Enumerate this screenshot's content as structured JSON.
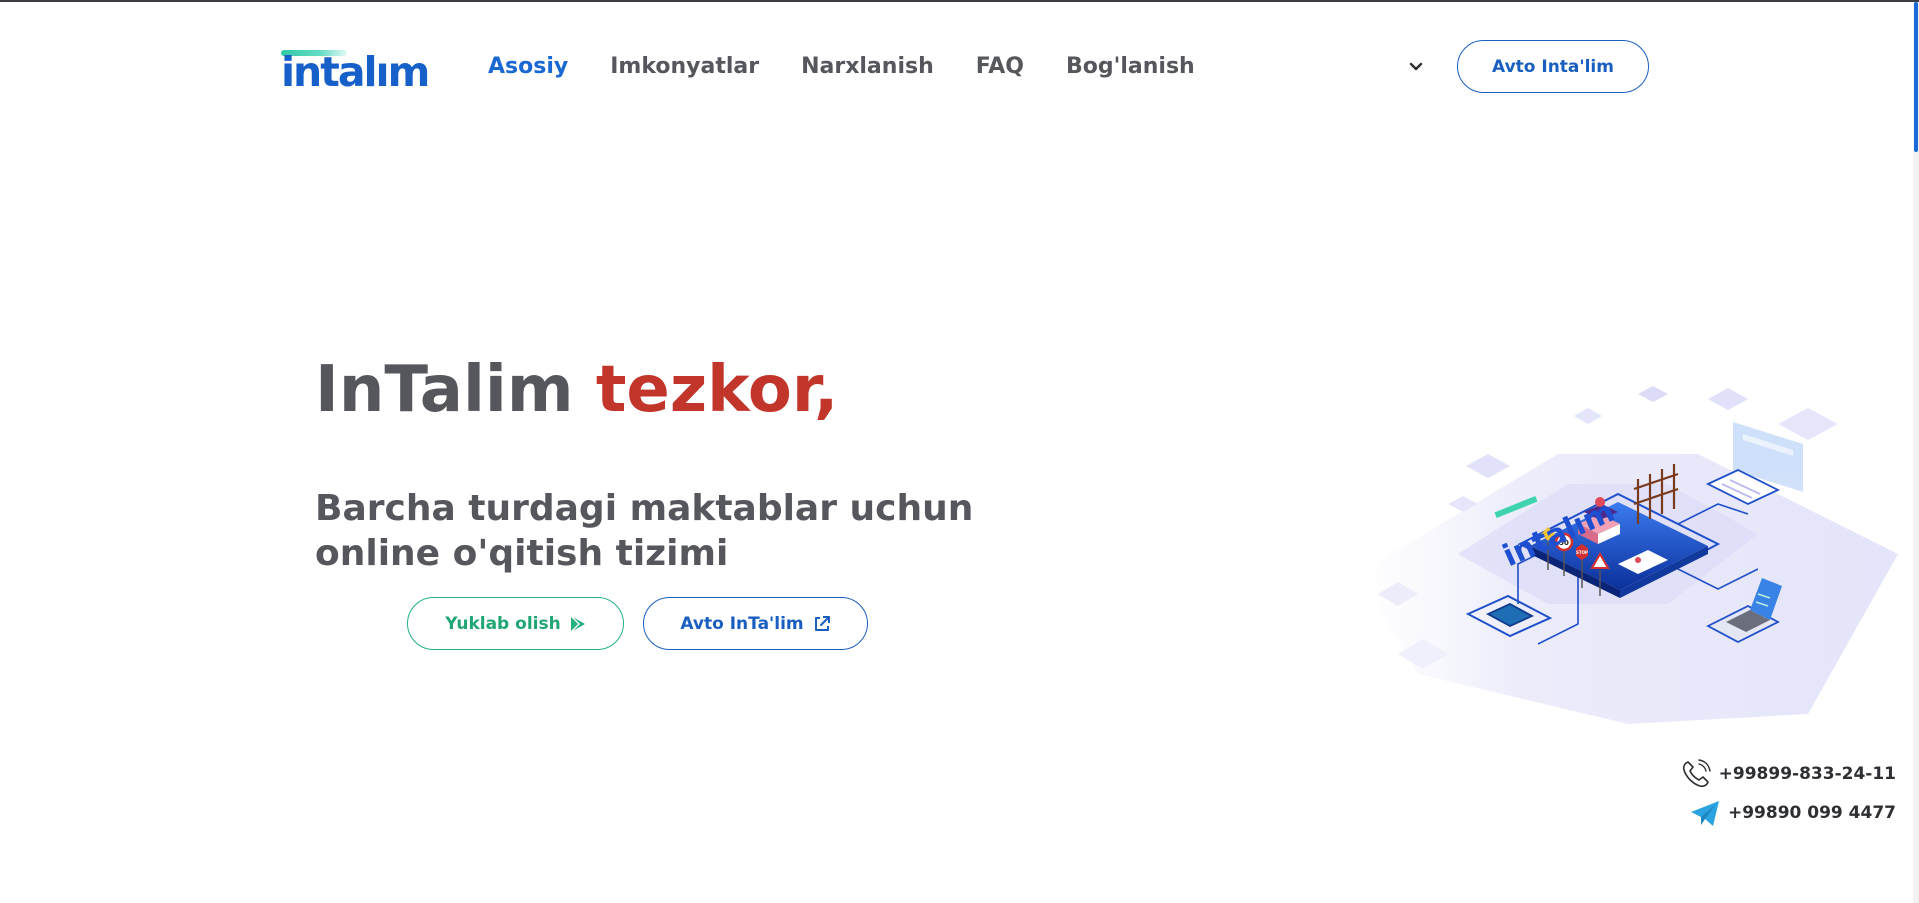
{
  "header": {
    "logo_text": "intalım",
    "nav": [
      {
        "label": "Asosiy",
        "active": true
      },
      {
        "label": "Imkonyatlar",
        "active": false
      },
      {
        "label": "Narxlanish",
        "active": false
      },
      {
        "label": "FAQ",
        "active": false
      },
      {
        "label": "Bog'lanish",
        "active": false
      }
    ],
    "lang_toggle_icon": "chevron-down-icon",
    "cta_label": "Avto Inta'lim"
  },
  "hero": {
    "title_part1": "InTalim",
    "title_part2": "tezkor,",
    "subtitle_line1": "Barcha turdagi maktablar uchun",
    "subtitle_line2": "online o'qitish tizimi",
    "download_label": "Yuklab olish",
    "download_icon": "play-store-icon",
    "open_label": "Avto InTa'lim",
    "open_icon": "external-link-icon"
  },
  "illustration": {
    "logo_text": "intalım",
    "sign_speed": "50",
    "sign_stop": "STOP"
  },
  "contacts": {
    "phone": "+99899-833-24-11",
    "phone_icon": "phone-icon",
    "telegram": "+99890 099 4477",
    "telegram_icon": "telegram-icon"
  },
  "colors": {
    "brand_blue": "#1a68d1",
    "accent_red": "#c2352a",
    "accent_green": "#23b27e",
    "text_gray": "#55575c"
  }
}
